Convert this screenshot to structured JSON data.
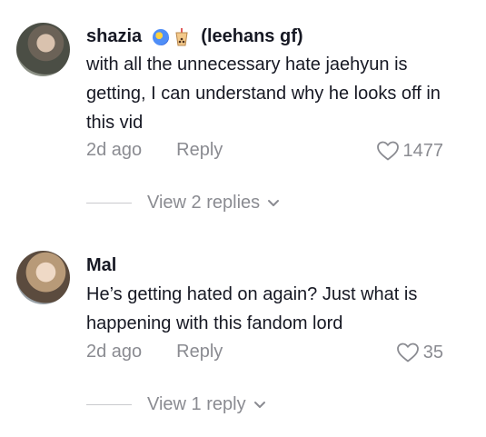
{
  "comments": [
    {
      "username": "shazia",
      "tag": "(leehans gf)",
      "text": "with all the unnecessary hate jaehyun is getting, I can understand why he looks off in this vid",
      "time": "2d ago",
      "reply_label": "Reply",
      "likes": "1477",
      "view_replies": "View 2 replies"
    },
    {
      "username": "Mal",
      "text": "He’s getting hated on again? Just what is happening with this fandom lord",
      "time": "2d ago",
      "reply_label": "Reply",
      "likes": "35",
      "view_replies": "View 1 reply"
    }
  ],
  "icons": {
    "badge1": "globe-badge-icon",
    "badge2": "bubble-tea-icon",
    "like": "heart-icon",
    "expand": "chevron-down-icon"
  },
  "colors": {
    "text": "#161823",
    "muted": "#8a8b91"
  }
}
